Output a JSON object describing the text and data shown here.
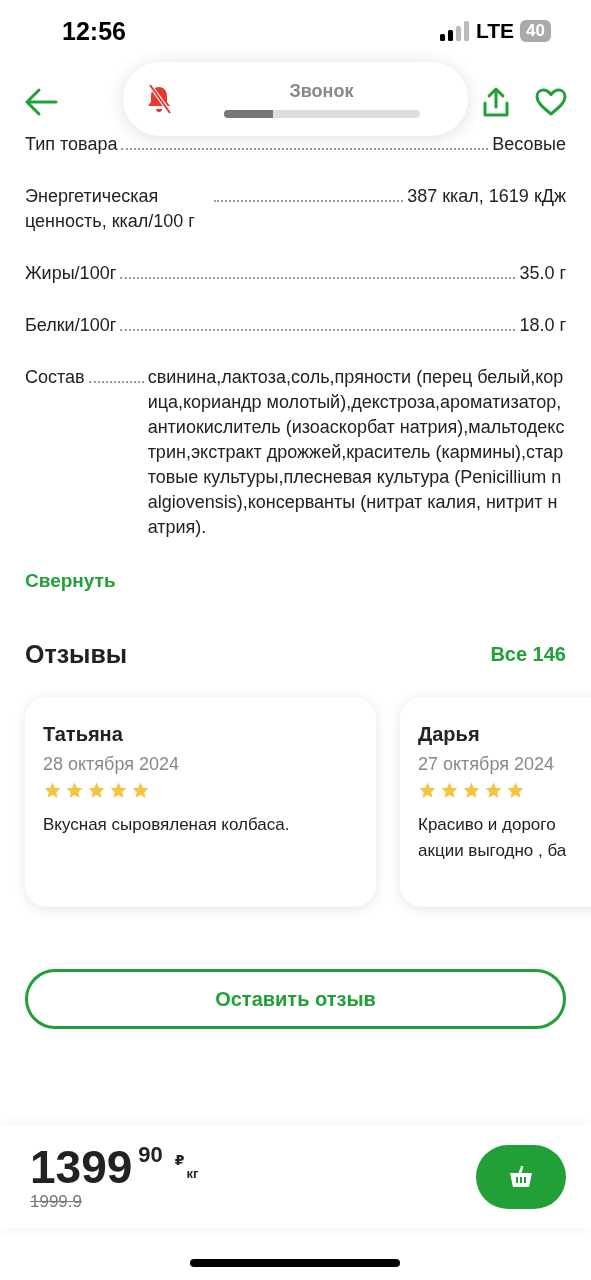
{
  "status_bar": {
    "time": "12:56",
    "network": "LTE",
    "battery": "40"
  },
  "volume_hud": {
    "label": "Звонок",
    "level": 0.25
  },
  "specs": [
    {
      "kind": "single",
      "label": "Тип товара",
      "value": "Весовые"
    },
    {
      "kind": "single",
      "label": "Энергетическая ценность, ккал/100 г",
      "value": "387 ккал, 1619 кДж"
    },
    {
      "kind": "single",
      "label": "Жиры/100г",
      "value": "35.0 г"
    },
    {
      "kind": "single",
      "label": "Белки/100г",
      "value": "18.0 г"
    },
    {
      "kind": "multiline",
      "label": "Состав",
      "value": "свинина,лактоза,соль,пряности (перец белый,корица,кориандр молотый),декстроза,ароматизатор,антиокислитель (изоаскорбат натрия),мальтодекстрин,экстракт дрожжей,краситель (кармины),стартовые культуры,плесневая культура (Penicillium nalgiovensis),консерванты (нитрат калия, нитрит натрия)."
    }
  ],
  "collapse_link": "Свернуть",
  "reviews": {
    "title": "Отзывы",
    "all_link": "Все 146",
    "items": [
      {
        "author": "Татьяна",
        "date": "28 октября 2024",
        "stars": 5,
        "lines": [
          "Вкусная сыровяленая колбаса."
        ]
      },
      {
        "author": "Дарья",
        "date": "27 октября 2024",
        "stars": 5,
        "lines": [
          "Красиво и дорого",
          "акции выгодно , ба"
        ]
      }
    ]
  },
  "leave_review_button": "Оставить отзыв",
  "price": {
    "main": "1399",
    "cents": "90",
    "currency": "₽",
    "unit": "кг",
    "old": "1999.9"
  }
}
